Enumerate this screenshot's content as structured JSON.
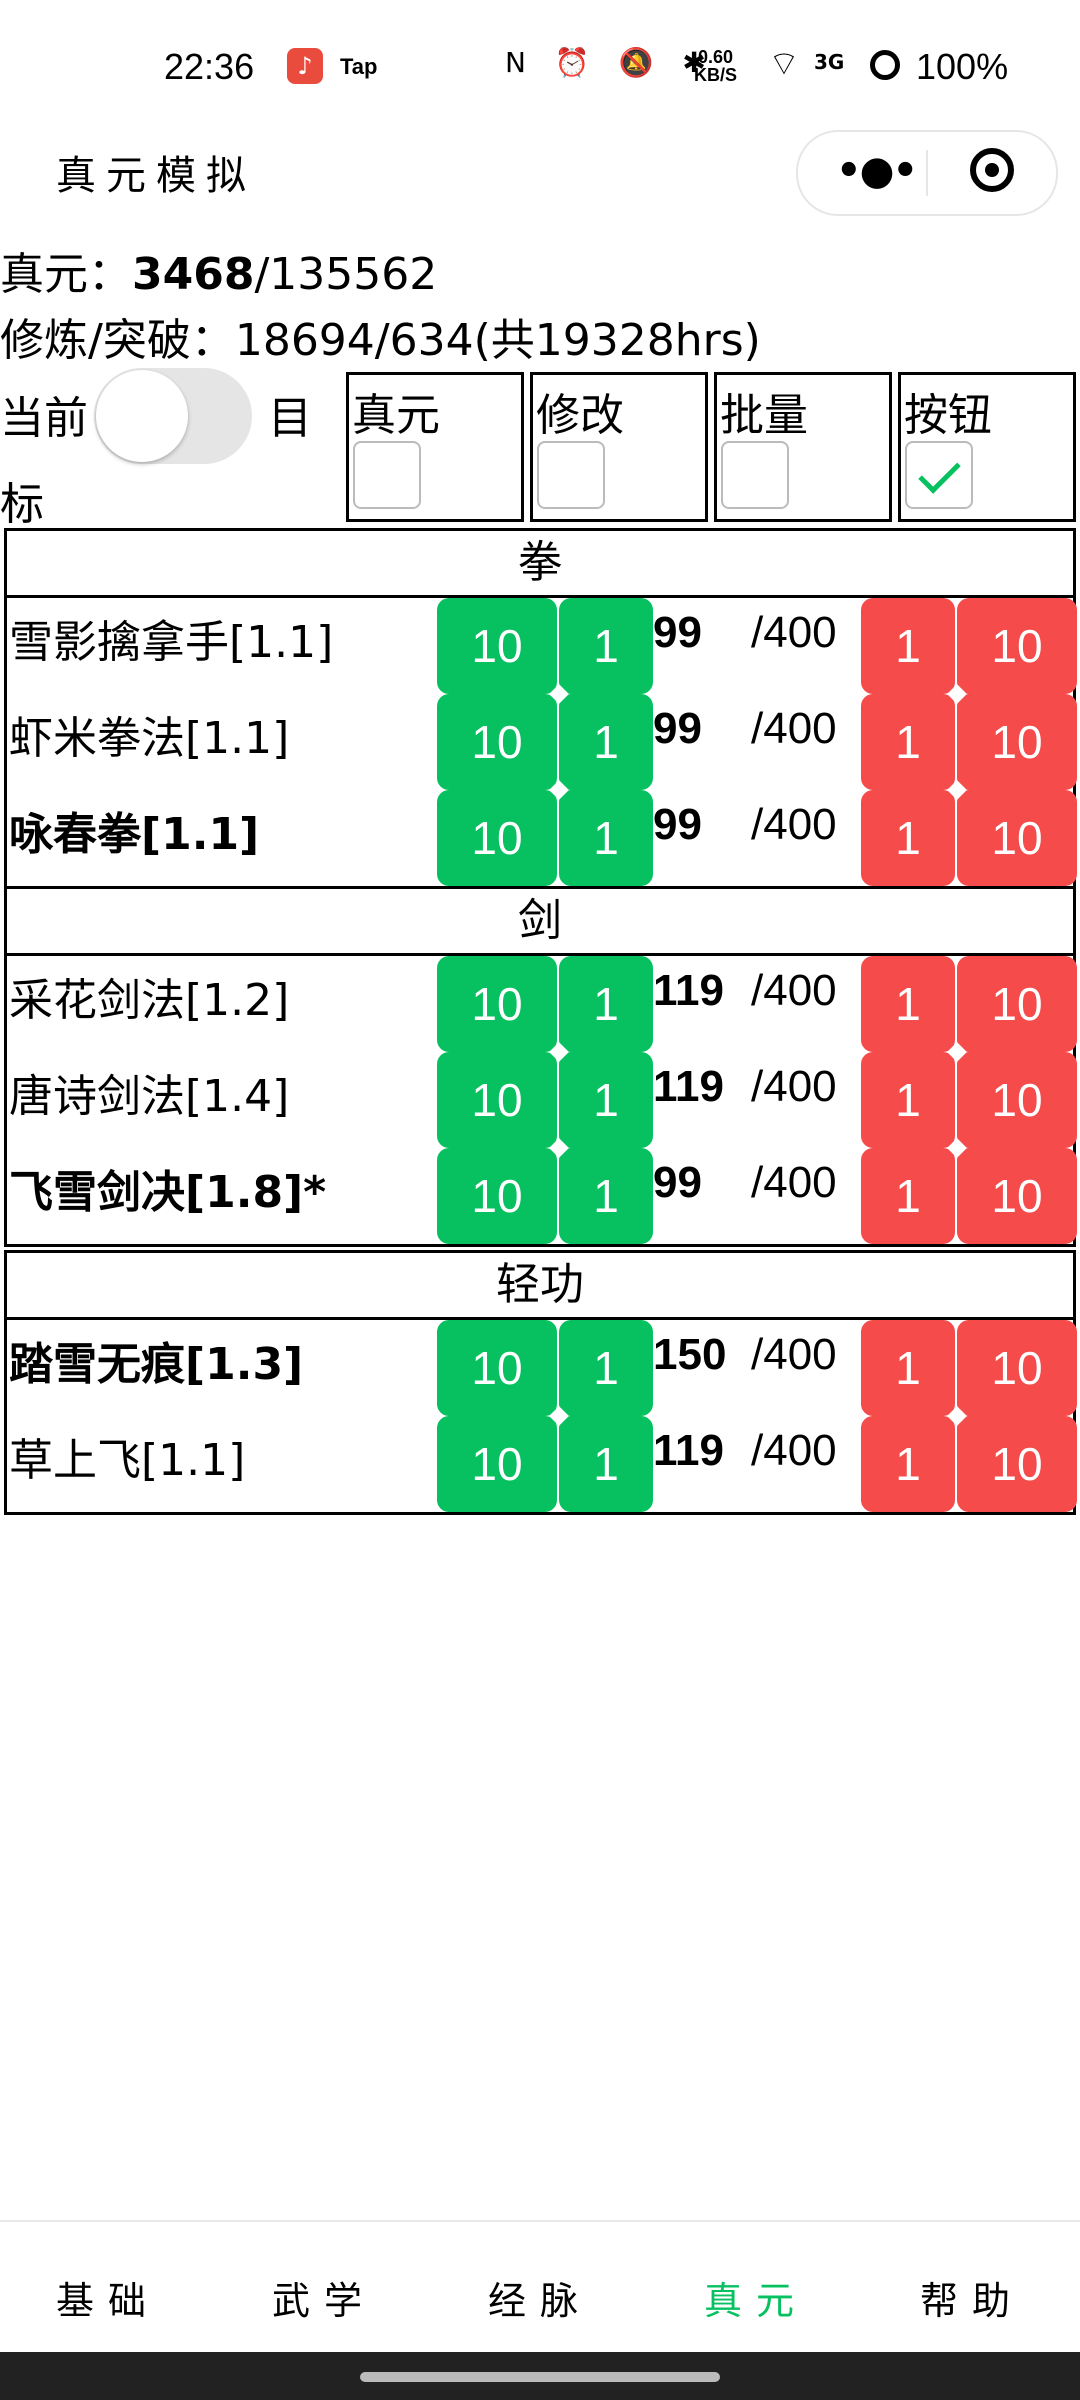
{
  "status_bar": {
    "time": "22:36",
    "app_icon_glyph": "♪",
    "app2_label": "Tap",
    "icons": "N ⏰ 🔕 ✱",
    "speed_value": "0.60",
    "speed_unit": "KB/S",
    "signal": "3G",
    "battery": "100%"
  },
  "title_bar": {
    "title": "真元模拟"
  },
  "summary": {
    "zhenyuan_label": "真元：",
    "zhenyuan_current": "3468",
    "zhenyuan_total": "/135562",
    "train_label": "修炼/突破：",
    "train_value": "18694/634(共19328hrs)"
  },
  "toggle": {
    "left_label": "当前",
    "right_label_top": "目",
    "right_label_bottom": "标"
  },
  "options": [
    {
      "label": "真元",
      "checked": false
    },
    {
      "label": "修改",
      "checked": false
    },
    {
      "label": "批量",
      "checked": false
    },
    {
      "label": "按钮",
      "checked": true
    }
  ],
  "buttons": {
    "plus10": "10",
    "plus1": "1",
    "minus1": "1",
    "minus10": "10"
  },
  "groups": [
    {
      "header": "拳",
      "rows": [
        {
          "name": "雪影擒拿手[1.1]",
          "bold": false,
          "cur": "99",
          "max": "/400"
        },
        {
          "name": "虾米拳法[1.1]",
          "bold": false,
          "cur": "99",
          "max": "/400"
        },
        {
          "name": "咏春拳[1.1]",
          "bold": true,
          "cur": "99",
          "max": "/400"
        }
      ]
    },
    {
      "header": "剑",
      "rows": [
        {
          "name": "采花剑法[1.2]",
          "bold": false,
          "cur": "119",
          "max": "/400"
        },
        {
          "name": "唐诗剑法[1.4]",
          "bold": false,
          "cur": "119",
          "max": "/400"
        },
        {
          "name": "飞雪剑决[1.8]*",
          "bold": true,
          "cur": "99",
          "max": "/400"
        }
      ]
    },
    {
      "header": "轻功",
      "rows": [
        {
          "name": "踏雪无痕[1.3]",
          "bold": true,
          "cur": "150",
          "max": "/400"
        },
        {
          "name": "草上飞[1.1]",
          "bold": false,
          "cur": "119",
          "max": "/400"
        }
      ]
    }
  ],
  "tabs": [
    {
      "label": "基础",
      "active": false
    },
    {
      "label": "武学",
      "active": false
    },
    {
      "label": "经脉",
      "active": false
    },
    {
      "label": "真元",
      "active": true
    },
    {
      "label": "帮助",
      "active": false
    }
  ],
  "colors": {
    "green": "#07c160",
    "red": "#f54b4b"
  }
}
